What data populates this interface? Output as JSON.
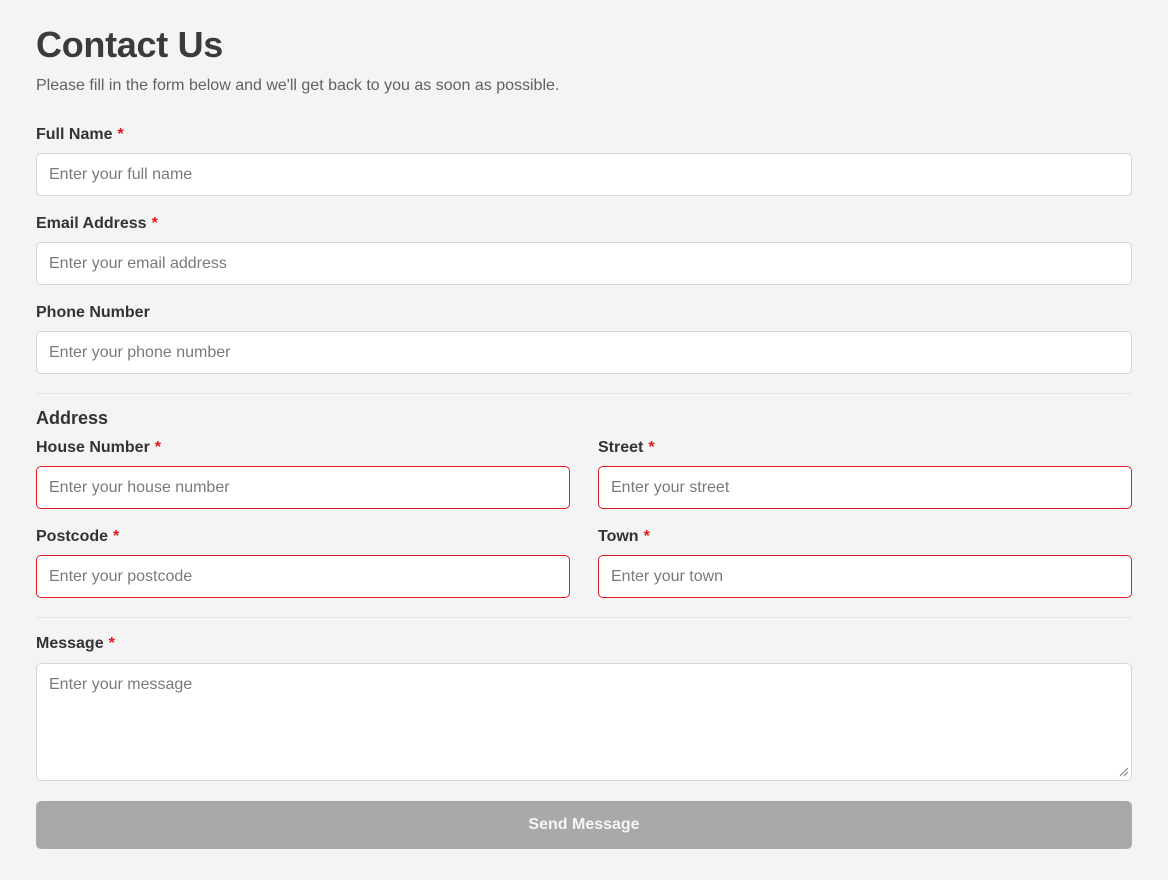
{
  "header": {
    "title": "Contact Us",
    "subtitle": "Please fill in the form below and we'll get back to you as soon as possible."
  },
  "fields": {
    "full_name": {
      "label": "Full Name",
      "required_marker": "*",
      "placeholder": "Enter your full name",
      "value": ""
    },
    "email": {
      "label": "Email Address",
      "required_marker": "*",
      "placeholder": "Enter your email address",
      "value": ""
    },
    "phone": {
      "label": "Phone Number",
      "placeholder": "Enter your phone number",
      "value": ""
    }
  },
  "address": {
    "section_title": "Address",
    "house_number": {
      "label": "House Number",
      "required_marker": "*",
      "placeholder": "Enter your house number",
      "value": ""
    },
    "street": {
      "label": "Street",
      "required_marker": "*",
      "placeholder": "Enter your street",
      "value": ""
    },
    "postcode": {
      "label": "Postcode",
      "required_marker": "*",
      "placeholder": "Enter your postcode",
      "value": ""
    },
    "town": {
      "label": "Town",
      "required_marker": "*",
      "placeholder": "Enter your town",
      "value": ""
    }
  },
  "message": {
    "label": "Message",
    "required_marker": "*",
    "placeholder": "Enter your message",
    "value": ""
  },
  "submit": {
    "label": "Send Message",
    "disabled": true
  },
  "colors": {
    "background": "#f4f4f5",
    "required_marker": "#e0161c",
    "error_border": "#e11b22",
    "submit_disabled": "#a9a9ab",
    "input_border": "#d6d6d9"
  },
  "icons": {
    "textarea_resize": "resize-grip-icon"
  }
}
